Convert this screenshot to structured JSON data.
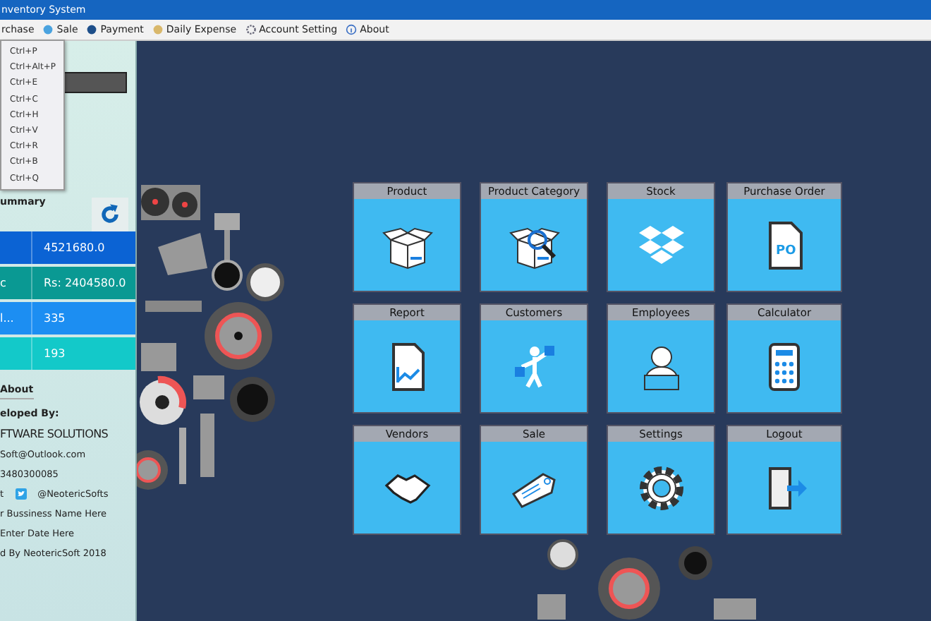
{
  "window": {
    "title": "nventory System"
  },
  "menu_bar": [
    "rchase",
    "Sale",
    "Payment",
    "Daily Expense",
    "Account Setting",
    "About"
  ],
  "dropdown": [
    "Ctrl+P",
    "Ctrl+Alt+P",
    "Ctrl+E",
    "Ctrl+C",
    "Ctrl+H",
    "Ctrl+V",
    "Ctrl+R",
    "Ctrl+B",
    "Ctrl+Q"
  ],
  "summary": {
    "title": "ummary",
    "rows": [
      {
        "label": "",
        "value": "4521680.0"
      },
      {
        "label": "c",
        "value": "Rs: 2404580.0"
      },
      {
        "label": "l...",
        "value": "335"
      },
      {
        "label": "",
        "value": "193"
      }
    ]
  },
  "about": {
    "title": "About",
    "developed_by": "eloped By:",
    "company": "FTWARE SOLUTIONS",
    "email": "Soft@Outlook.com",
    "phone": "3480300085",
    "contact_label": "t",
    "twitter": "@NeotericSofts",
    "business_name": "r Bussiness Name Here",
    "date": "Enter Date Here",
    "credit": "d  By  NeotericSoft 2018"
  },
  "tiles": [
    {
      "label": "Product"
    },
    {
      "label": "Product Category"
    },
    {
      "label": "Stock"
    },
    {
      "label": "Purchase Order",
      "icon_text": "PO"
    },
    {
      "label": "Report"
    },
    {
      "label": "Customers"
    },
    {
      "label": "Employees"
    },
    {
      "label": "Calculator"
    },
    {
      "label": "Vendors"
    },
    {
      "label": "Sale"
    },
    {
      "label": "Settings"
    },
    {
      "label": "Logout"
    }
  ]
}
